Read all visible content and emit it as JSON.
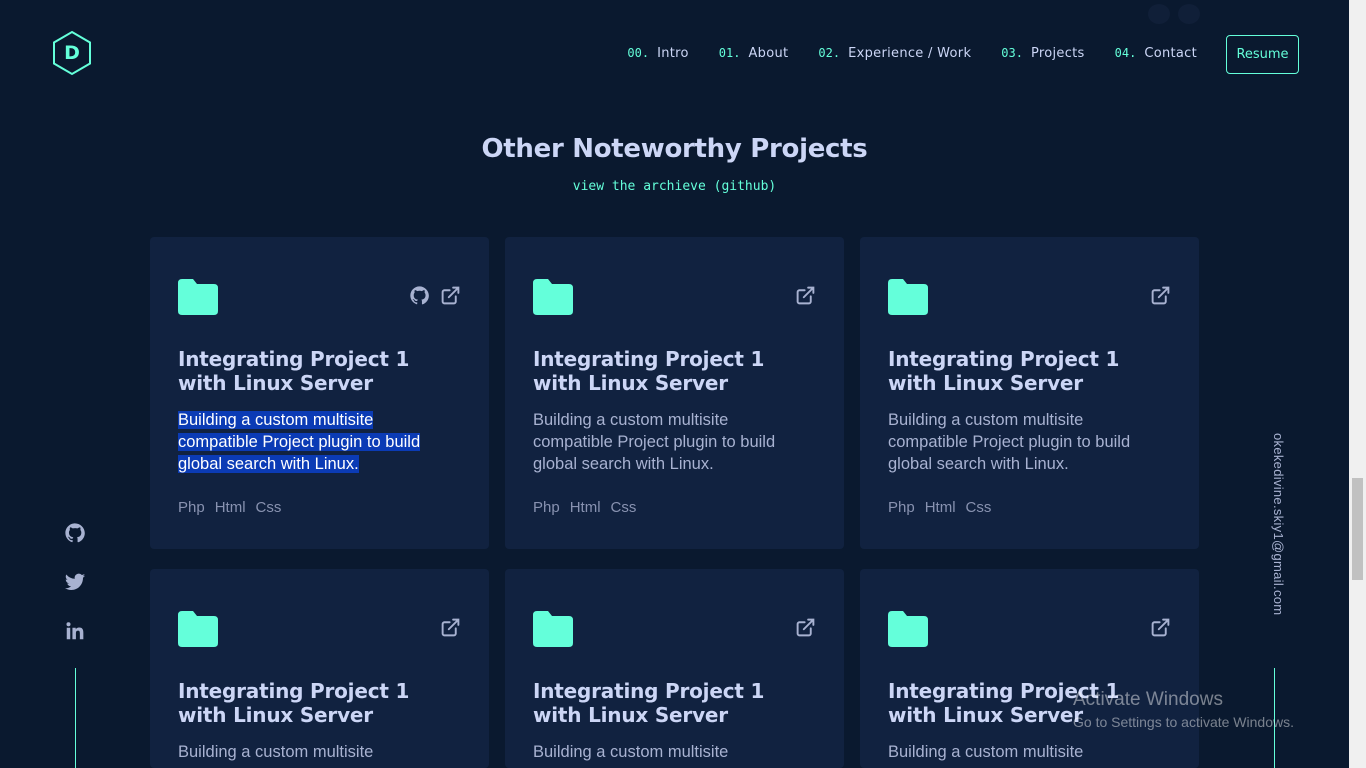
{
  "header": {
    "logo_letter": "D",
    "nav": [
      {
        "num": "00.",
        "label": "Intro"
      },
      {
        "num": "01.",
        "label": "About"
      },
      {
        "num": "02.",
        "label": "Experience / Work"
      },
      {
        "num": "03.",
        "label": "Projects"
      },
      {
        "num": "04.",
        "label": "Contact"
      }
    ],
    "resume_label": "Resume"
  },
  "section": {
    "title": "Other Noteworthy Projects",
    "archive_link": "view the archieve (github)"
  },
  "cards": [
    {
      "title": "Integrating Project 1 with Linux Server",
      "description": "Building a custom multisite compatible Project plugin to build global search with Linux.",
      "tags": [
        "Php",
        "Html",
        "Css"
      ],
      "links": [
        "github-icon",
        "external-link-icon"
      ],
      "selected": true
    },
    {
      "title": "Integrating Project 1 with Linux Server",
      "description": "Building a custom multisite compatible Project plugin to build global search with Linux.",
      "tags": [
        "Php",
        "Html",
        "Css"
      ],
      "links": [
        "external-link-icon"
      ]
    },
    {
      "title": "Integrating Project 1 with Linux Server",
      "description": "Building a custom multisite compatible Project plugin to build global search with Linux.",
      "tags": [
        "Php",
        "Html",
        "Css"
      ],
      "links": [
        "external-link-icon"
      ]
    },
    {
      "title": "Integrating Project 1 with Linux Server",
      "description": "Building a custom multisite",
      "tags": [],
      "links": [
        "external-link-icon"
      ]
    },
    {
      "title": "Integrating Project 1 with Linux Server",
      "description": "Building a custom multisite",
      "tags": [],
      "links": [
        "external-link-icon"
      ]
    },
    {
      "title": "Integrating Project 1 with Linux Server",
      "description": "Building a custom multisite",
      "tags": [],
      "links": [
        "external-link-icon"
      ]
    }
  ],
  "social": [
    "github-icon",
    "twitter-icon",
    "linkedin-icon"
  ],
  "email": "okekedivine.skiy1@gmail.com",
  "watermark": {
    "line1": "Activate Windows",
    "line2": "Go to Settings to activate Windows."
  },
  "colors": {
    "background": "#0a192f",
    "card": "#112240",
    "accent": "#64ffda",
    "heading": "#ccd6f6",
    "text": "#8892b0"
  }
}
